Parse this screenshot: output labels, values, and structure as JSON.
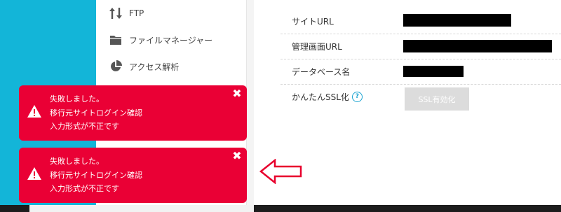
{
  "sidebar": {
    "items": [
      {
        "label": "FTP",
        "icon": "ftp-transfer-icon"
      },
      {
        "label": "ファイルマネージャー",
        "icon": "folder-icon"
      },
      {
        "label": "アクセス解析",
        "icon": "pie-chart-icon"
      }
    ]
  },
  "site_info": {
    "rows": [
      {
        "label": "サイトURL"
      },
      {
        "label": "管理画面URL"
      },
      {
        "label": "データベース名"
      },
      {
        "label": "かんたんSSL化",
        "help_icon": "help-icon"
      }
    ],
    "ssl_button_label": "SSL有効化"
  },
  "notifications": [
    {
      "line1": "失敗しました。",
      "line2": "移行元サイトログイン確認",
      "line3": "入力形式が不正です",
      "close": "✖"
    },
    {
      "line1": "失敗しました。",
      "line2": "移行元サイトログイン確認",
      "line3": "入力形式が不正です",
      "close": "✖"
    }
  ],
  "colors": {
    "toast": "#ea0035",
    "sidebar_strip": "#13b5d8",
    "arrow_outline": "#e8002d",
    "help": "#17a2d0",
    "ssl_button": "#dcdcdc"
  }
}
